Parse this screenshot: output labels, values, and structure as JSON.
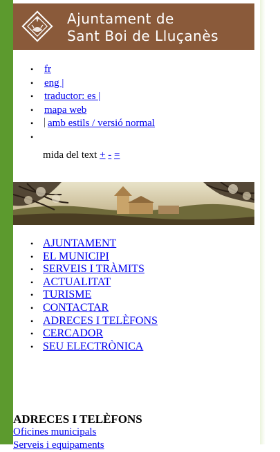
{
  "header": {
    "title_line1": "Ajuntament de",
    "title_line2": "Sant Boi de Lluçanès"
  },
  "languages": [
    {
      "label": "fr"
    },
    {
      "label": "eng |"
    },
    {
      "label": "traductor: es |"
    },
    {
      "label": "mapa web"
    },
    {
      "label": "amb estils / versió normal"
    },
    {
      "label": ""
    }
  ],
  "text_size": {
    "label": "mida del text",
    "increase": "+",
    "decrease": "-",
    "reset": "="
  },
  "nav": [
    "AJUNTAMENT",
    "EL MUNICIPI",
    "SERVEIS I TRÀMITS",
    "ACTUALITAT",
    "TURISME",
    "CONTACTAR",
    "ADRECES I TELÈFONS",
    "CERCADOR",
    "SEU ELECTRÒNICA"
  ],
  "section": {
    "title": "ADRECES I TELÈFONS",
    "links": [
      "Oficines municipals",
      "Serveis i equipaments"
    ]
  },
  "colors": {
    "left_bar": "#5c9a2e",
    "header_bg": "#8a5a3a",
    "link": "#0000ee"
  },
  "icons": {
    "crest": "coat-of-arms-icon"
  }
}
